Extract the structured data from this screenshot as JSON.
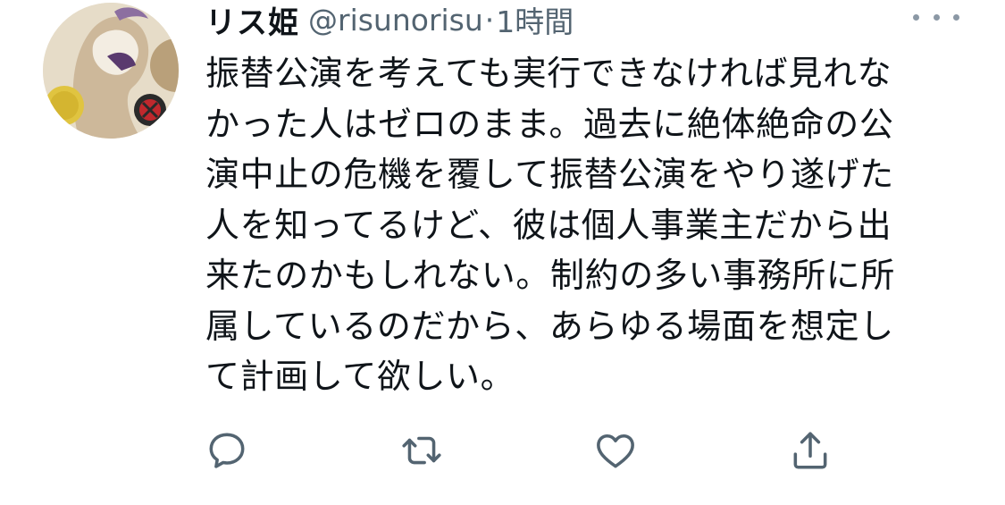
{
  "tweet": {
    "author": {
      "display_name": "リス姫",
      "handle": "@risunorisu",
      "separator": "·",
      "time": "1時間"
    },
    "text_lines": [
      "振替公演を考えても実行できなければ見れな",
      "かった人はゼロのまま。過去に絶体絶命の公",
      "演中止の危機を覆して振替公演をやり遂げた",
      "人を知ってるけど、彼は個人事業主だから出",
      "来たのかもしれない。制約の多い事務所に所",
      "属しているのだから、あらゆる場面を想定し",
      "て計画して欲しい。"
    ]
  },
  "icons": {
    "more": "more-dots-icon",
    "reply": "reply-icon",
    "retweet": "retweet-icon",
    "like": "heart-icon",
    "share": "share-icon"
  },
  "colors": {
    "text": "#0f1419",
    "secondary": "#536471",
    "icon": "#536471"
  }
}
